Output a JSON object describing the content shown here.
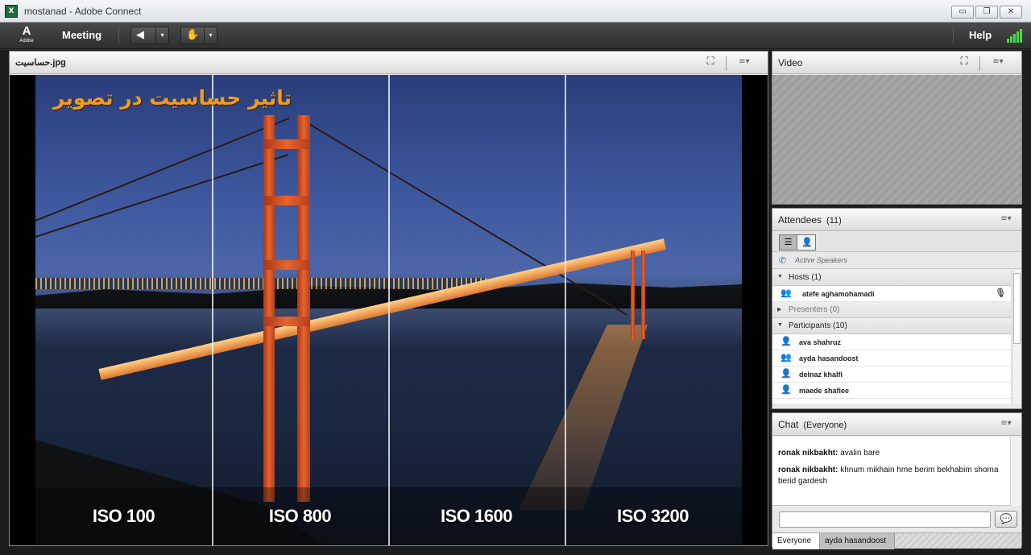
{
  "window": {
    "title": "mostanad - Adobe Connect",
    "app_icon_glyph": "X",
    "minimize_glyph": "▭",
    "restore_glyph": "❐",
    "close_glyph": "✕"
  },
  "appbar": {
    "logo_mark": "A",
    "logo_word": "Adobe",
    "meeting_menu": "Meeting",
    "audio_icon": "speaker-icon",
    "audio_glyph": "◀",
    "status_icon": "raise-hand-icon",
    "status_glyph": "✋",
    "drop_glyph": "▾",
    "help_menu": "Help",
    "signal_icon": "connection-signal-icon"
  },
  "share_pod": {
    "title": "حساسیت.jpg",
    "fullscreen_glyph": "⛶",
    "menu_glyph": "≡▾",
    "image": {
      "overlay_title": "تاثیر حساسیت در تصویر",
      "iso_labels": [
        "ISO 100",
        "ISO 800",
        "ISO 1600",
        "ISO 3200"
      ]
    }
  },
  "video_pod": {
    "title": "Video",
    "fullscreen_glyph": "⛶",
    "menu_glyph": "≡▾"
  },
  "attendees_pod": {
    "title": "Attendees",
    "count": "(11)",
    "menu_glyph": "≡▾",
    "list_view_glyph": "☰",
    "detail_view_glyph": "👤",
    "active_speakers_glyph": "✆",
    "active_speakers": "Active Speakers",
    "expanded_glyph": "▼",
    "collapsed_glyph": "▶",
    "person_glyph": "👤",
    "host_glyph": "👥",
    "mic_glyph": "🎙",
    "groups": {
      "hosts": "Hosts (1)",
      "presenters": "Presenters (0)",
      "participants": "Participants (10)"
    },
    "host": "atefe aghamohamadi",
    "participants": [
      {
        "name": "ava shahruz",
        "role": "participant"
      },
      {
        "name": "ayda hasandoost",
        "role": "presenter-capable"
      },
      {
        "name": "delnaz khalfi",
        "role": "participant"
      },
      {
        "name": "maede shafiee",
        "role": "participant"
      }
    ]
  },
  "chat_pod": {
    "title": "Chat",
    "scope": "(Everyone)",
    "menu_glyph": "≡▾",
    "send_glyph": "💬",
    "messages": [
      {
        "sender": "ronak nikbakht:",
        "text": "avalin bare"
      },
      {
        "sender": "ronak nikbakht:",
        "text": "khnum mikhain hme berim bekhabim shoma berid gardesh"
      }
    ],
    "input_placeholder": "",
    "tabs": [
      "Everyone",
      "ayda hasandoost"
    ]
  },
  "colors": {
    "accent_orange": "#f29b1c",
    "signal_green": "#4bd64b",
    "appbar_dark": "#2e2e2e"
  }
}
